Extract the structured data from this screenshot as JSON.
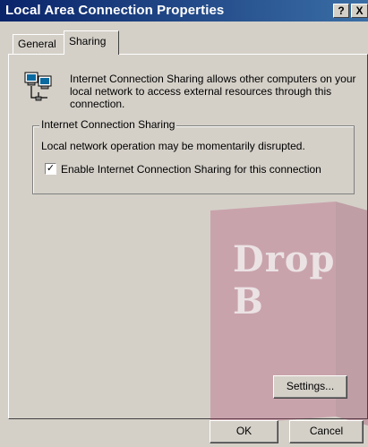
{
  "window": {
    "title": "Local Area Connection Properties",
    "help_label": "?",
    "close_label": "X"
  },
  "tabs": [
    {
      "label": "General",
      "selected": false
    },
    {
      "label": "Sharing",
      "selected": true
    }
  ],
  "sharing": {
    "intro": "Internet Connection Sharing allows other computers on your local network to access external resources through this connection.",
    "group_title": "Internet Connection Sharing",
    "disruption_note": "Local network operation may be momentarily disrupted.",
    "enable_label": "Enable Internet Connection Sharing for this connection",
    "enable_checked": true,
    "settings_button": "Settings..."
  },
  "buttons": {
    "ok": "OK",
    "cancel": "Cancel"
  },
  "watermark": {
    "text": "Drop B"
  },
  "colors": {
    "title_start": "#0a246a",
    "title_end": "#3a6ea5",
    "face": "#d4d0c8",
    "watermark": "#b03a6b"
  }
}
